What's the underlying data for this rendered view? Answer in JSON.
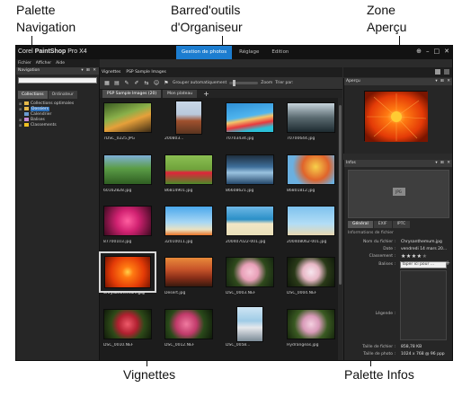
{
  "annotations": {
    "palette_navigation": [
      "Palette",
      "Navigation"
    ],
    "organizer_toolbar": [
      "Barred'outils",
      "d'Organiseur"
    ],
    "preview_zone": [
      "Zone",
      "Aperçu"
    ],
    "thumbnails": "Vignettes",
    "info_palette": "Palette Infos"
  },
  "app": {
    "brand_prefix": "Corel",
    "brand_bold": "PaintShop",
    "brand_suffix": "Pro X4",
    "mode_tabs": [
      "Gestion de photos",
      "Réglage",
      "Edition"
    ],
    "window_controls": [
      "⊕",
      "–",
      "□",
      "✕"
    ]
  },
  "menu": [
    "Fichier",
    "Afficher",
    "Aide"
  ],
  "navigation": {
    "title": "Navigation",
    "search_placeholder": "",
    "tabs": [
      "Collections",
      "Ordinateur"
    ],
    "tree": [
      {
        "label": "Collections optimales",
        "selected": false
      },
      {
        "label": "Dossiers",
        "selected": true
      },
      {
        "label": "Calendrier",
        "selected": false
      },
      {
        "label": "Balises",
        "selected": false
      },
      {
        "label": "Classements",
        "selected": false
      }
    ]
  },
  "organizer": {
    "top_tabs": [
      "Vignettes",
      "PSP Sample Images"
    ],
    "group_label": "Grouper automatiquement",
    "zoom_label": "Zoom",
    "sort_label": "Trier par:",
    "doc_tabs": [
      "PSP Sample Images (20)",
      "Mon plateau"
    ]
  },
  "thumbnails": [
    {
      "label": "7DSC_0225.JPG"
    },
    {
      "label": "200803..."
    },
    {
      "label": "70703434.jpg"
    },
    {
      "label": "70700644.jpg"
    },
    {
      "label": "60162828.jpg"
    },
    {
      "label": "86814901.jpg"
    },
    {
      "label": "86608621.jpg"
    },
    {
      "label": "86801812.jpg"
    },
    {
      "label": "87700103.jpg"
    },
    {
      "label": "32010011.jpg"
    },
    {
      "label": "200407022-001.jpg"
    },
    {
      "label": "200408062-001.jpg"
    },
    {
      "label": "Chrysanthemum.jpg"
    },
    {
      "label": "Desert.jpg"
    },
    {
      "label": "DSC_0003.NEF"
    },
    {
      "label": "DSC_0004.NEF"
    },
    {
      "label": "DSC_0010.NEF"
    },
    {
      "label": "DSC_0012.NEF"
    },
    {
      "label": "DSC_0058..."
    },
    {
      "label": "Hydrangeas.jpg"
    }
  ],
  "preview": {
    "title": "Aperçu"
  },
  "infos": {
    "title": "Infos",
    "badge": "JPG",
    "tabs": [
      "Général",
      "EXIF",
      "IPTC"
    ],
    "section": "Informations de fichier",
    "fields": [
      {
        "key": "Nom du fichier :",
        "value": "Chrysanthemum.jpg"
      },
      {
        "key": "Date :",
        "value": "vendredi 14 mars 20..."
      },
      {
        "key": "Classement :",
        "value": ""
      },
      {
        "key": "Balises :",
        "value": "Taper ici pour ..."
      },
      {
        "key": "Légende :",
        "value": ""
      },
      {
        "key": "Taille de fichier :",
        "value": "858,78 KB"
      },
      {
        "key": "Taille de photo :",
        "value": "1024 x 768 @ 96 ppp"
      }
    ],
    "rating": 4,
    "rating_max": 5
  },
  "colors": {
    "accent": "#1c7dd0",
    "star": "#f0c020"
  }
}
